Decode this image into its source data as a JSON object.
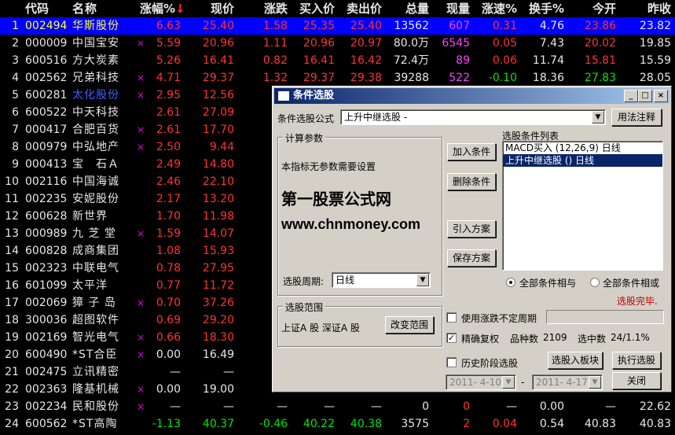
{
  "header": {
    "code": "代码",
    "name": "名称",
    "pct": "涨幅%",
    "sort_arrow": "↓",
    "price": "现价",
    "chg": "涨跌",
    "bid": "买入价",
    "ask": "卖出价",
    "vol": "总量",
    "cur": "现量",
    "spd": "涨速%",
    "turn": "换手%",
    "open": "今开",
    "prev": "昨收"
  },
  "rows": [
    {
      "idx": "1",
      "code": "002494",
      "name": "华斯股份",
      "star": "",
      "pct": "6.63",
      "price": "25.40",
      "chg": "1.58",
      "bid": "25.35",
      "ask": "25.40",
      "vol": "13562",
      "cur": "607",
      "spd": "0.31",
      "turn": "4.76",
      "open": "23.86",
      "prev": "23.82"
    },
    {
      "idx": "2",
      "code": "000009",
      "name": "中国宝安",
      "star": "×",
      "pct": "5.59",
      "price": "20.96",
      "chg": "1.11",
      "bid": "20.96",
      "ask": "20.97",
      "vol": "80.0万",
      "cur": "6545",
      "spd": "0.05",
      "turn": "7.43",
      "open": "20.02",
      "prev": "19.85"
    },
    {
      "idx": "3",
      "code": "600516",
      "name": "方大炭素",
      "star": "",
      "pct": "5.26",
      "price": "16.41",
      "chg": "0.82",
      "bid": "16.41",
      "ask": "16.42",
      "vol": "72.4万",
      "cur": "89",
      "spd": "0.06",
      "turn": "11.74",
      "open": "15.81",
      "prev": "15.59"
    },
    {
      "idx": "4",
      "code": "002562",
      "name": "兄弟科技",
      "star": "×",
      "pct": "4.71",
      "price": "29.37",
      "chg": "1.32",
      "bid": "29.37",
      "ask": "29.38",
      "vol": "39288",
      "cur": "522",
      "spd": "-0.10",
      "turn": "18.36",
      "open": "27.83",
      "prev": "28.05"
    },
    {
      "idx": "5",
      "code": "600281",
      "name": "太化股份",
      "star": "×",
      "pct": "2.95",
      "price": "12.56",
      "chg": "",
      "bid": "",
      "ask": "",
      "vol": "",
      "cur": "",
      "spd": "",
      "turn": "",
      "open": "",
      "prev": ""
    },
    {
      "idx": "6",
      "code": "600522",
      "name": "中天科技",
      "star": "",
      "pct": "2.61",
      "price": "27.09",
      "chg": "",
      "bid": "",
      "ask": "",
      "vol": "",
      "cur": "",
      "spd": "",
      "turn": "",
      "open": "",
      "prev": ""
    },
    {
      "idx": "7",
      "code": "000417",
      "name": "合肥百货",
      "star": "×",
      "pct": "2.61",
      "price": "17.70",
      "chg": "",
      "bid": "",
      "ask": "",
      "vol": "",
      "cur": "",
      "spd": "",
      "turn": "",
      "open": "",
      "prev": ""
    },
    {
      "idx": "8",
      "code": "000979",
      "name": "中弘地产",
      "star": "×",
      "pct": "2.50",
      "price": "9.44",
      "chg": "",
      "bid": "",
      "ask": "",
      "vol": "",
      "cur": "",
      "spd": "",
      "turn": "",
      "open": "",
      "prev": ""
    },
    {
      "idx": "9",
      "code": "000413",
      "name": "宝　石Ａ",
      "star": "",
      "pct": "2.49",
      "price": "14.80",
      "chg": "",
      "bid": "",
      "ask": "",
      "vol": "",
      "cur": "",
      "spd": "",
      "turn": "",
      "open": "",
      "prev": ""
    },
    {
      "idx": "10",
      "code": "002116",
      "name": "中国海诚",
      "star": "",
      "pct": "2.46",
      "price": "22.10",
      "chg": "",
      "bid": "",
      "ask": "",
      "vol": "",
      "cur": "",
      "spd": "",
      "turn": "",
      "open": "",
      "prev": ""
    },
    {
      "idx": "11",
      "code": "002235",
      "name": "安妮股份",
      "star": "",
      "pct": "2.17",
      "price": "13.20",
      "chg": "",
      "bid": "",
      "ask": "",
      "vol": "",
      "cur": "",
      "spd": "",
      "turn": "",
      "open": "",
      "prev": ""
    },
    {
      "idx": "12",
      "code": "600628",
      "name": "新世界",
      "star": "",
      "pct": "1.70",
      "price": "11.98",
      "chg": "",
      "bid": "",
      "ask": "",
      "vol": "",
      "cur": "",
      "spd": "",
      "turn": "",
      "open": "",
      "prev": ""
    },
    {
      "idx": "13",
      "code": "000989",
      "name": "九 芝 堂",
      "star": "×",
      "pct": "1.59",
      "price": "14.07",
      "chg": "",
      "bid": "",
      "ask": "",
      "vol": "",
      "cur": "",
      "spd": "",
      "turn": "",
      "open": "",
      "prev": ""
    },
    {
      "idx": "14",
      "code": "600828",
      "name": "成商集团",
      "star": "",
      "pct": "1.08",
      "price": "15.93",
      "chg": "",
      "bid": "",
      "ask": "",
      "vol": "",
      "cur": "",
      "spd": "",
      "turn": "",
      "open": "",
      "prev": ""
    },
    {
      "idx": "15",
      "code": "002323",
      "name": "中联电气",
      "star": "",
      "pct": "0.78",
      "price": "27.95",
      "chg": "",
      "bid": "",
      "ask": "",
      "vol": "",
      "cur": "",
      "spd": "",
      "turn": "",
      "open": "",
      "prev": ""
    },
    {
      "idx": "16",
      "code": "601099",
      "name": "太平洋",
      "star": "",
      "pct": "0.77",
      "price": "11.72",
      "chg": "",
      "bid": "",
      "ask": "",
      "vol": "",
      "cur": "",
      "spd": "",
      "turn": "",
      "open": "",
      "prev": ""
    },
    {
      "idx": "17",
      "code": "002069",
      "name": "獐 子 岛",
      "star": "×",
      "pct": "0.70",
      "price": "37.26",
      "chg": "",
      "bid": "",
      "ask": "",
      "vol": "",
      "cur": "",
      "spd": "",
      "turn": "",
      "open": "",
      "prev": ""
    },
    {
      "idx": "18",
      "code": "300036",
      "name": "超图软件",
      "star": "",
      "pct": "0.69",
      "price": "29.20",
      "chg": "",
      "bid": "",
      "ask": "",
      "vol": "",
      "cur": "",
      "spd": "",
      "turn": "",
      "open": "",
      "prev": ""
    },
    {
      "idx": "19",
      "code": "002169",
      "name": "智光电气",
      "star": "×",
      "pct": "0.66",
      "price": "18.30",
      "chg": "",
      "bid": "",
      "ask": "",
      "vol": "",
      "cur": "",
      "spd": "",
      "turn": "",
      "open": "",
      "prev": ""
    },
    {
      "idx": "20",
      "code": "600490",
      "name": "*ST合臣",
      "star": "×",
      "pct": "0.00",
      "price": "16.49",
      "chg": "",
      "bid": "",
      "ask": "",
      "vol": "",
      "cur": "",
      "spd": "",
      "turn": "",
      "open": "",
      "prev": ""
    },
    {
      "idx": "21",
      "code": "002475",
      "name": "立讯精密",
      "star": "",
      "pct": "—",
      "price": "—",
      "chg": "",
      "bid": "",
      "ask": "",
      "vol": "",
      "cur": "",
      "spd": "",
      "turn": "",
      "open": "",
      "prev": ""
    },
    {
      "idx": "22",
      "code": "002363",
      "name": "隆基机械",
      "star": "×",
      "pct": "0.00",
      "price": "19.00",
      "chg": "",
      "bid": "",
      "ask": "",
      "vol": "",
      "cur": "",
      "spd": "",
      "turn": "",
      "open": "",
      "prev": ""
    },
    {
      "idx": "23",
      "code": "002234",
      "name": "民和股份",
      "star": "×",
      "pct": "—",
      "price": "—",
      "chg": "—",
      "bid": "—",
      "ask": "—",
      "vol": "0",
      "cur": "0",
      "spd": "—",
      "turn": "0.00",
      "open": "—",
      "prev": "22.62"
    },
    {
      "idx": "24",
      "code": "600562",
      "name": "*ST高陶",
      "star": "",
      "pct": "-1.13",
      "price": "40.37",
      "chg": "-0.46",
      "bid": "40.22",
      "ask": "40.38",
      "vol": "3575",
      "cur": "2",
      "spd": "0.04",
      "turn": "0.54",
      "open": "40.83",
      "prev": "40.83"
    }
  ],
  "dialog": {
    "title": "条件选股",
    "formula_label": "条件选股公式",
    "formula_value": "上升中继选股 -",
    "help_button": "用法注释",
    "params_group": "计算参数",
    "params_text": "本指标无参数需要设置",
    "watermark_cn": "第一股票公式网",
    "watermark_url": "www.chnmoney.com",
    "period_label": "选股周期:",
    "period_value": "日线",
    "add_button": "加入条件",
    "delete_button": "删除条件",
    "import_button": "引入方案",
    "save_button": "保存方案",
    "list_title": "选股条件列表",
    "conditions": [
      "MACD买入 (12,26,9) 日线",
      "上升中继选股 () 日线"
    ],
    "radio_and": "全部条件相与",
    "radio_or": "全部条件相或",
    "status": "选股完毕.",
    "range_group": "选股范围",
    "range_text": "上证A 股 深证A 股",
    "range_button": "改变范围",
    "use_period_label": "使用涨跌不定周期",
    "exact_label": "精确复权",
    "count_label": "品种数",
    "count_value": "2109",
    "selected_label": "选中数",
    "selected_value": "24/1.1%",
    "history_label": "历史阶段选股",
    "to_board_button": "选股入板块",
    "execute_button": "执行选股",
    "date_from": "2011- 4-10",
    "date_dash": "-",
    "date_to": "2011- 4-17",
    "close_button": "关闭"
  },
  "colors": {
    "up": "#ff3232",
    "down": "#00e600",
    "selected_row": "#0000ff",
    "dialog_bg": "#d4d0c8",
    "title_bar": "#0a246a"
  }
}
